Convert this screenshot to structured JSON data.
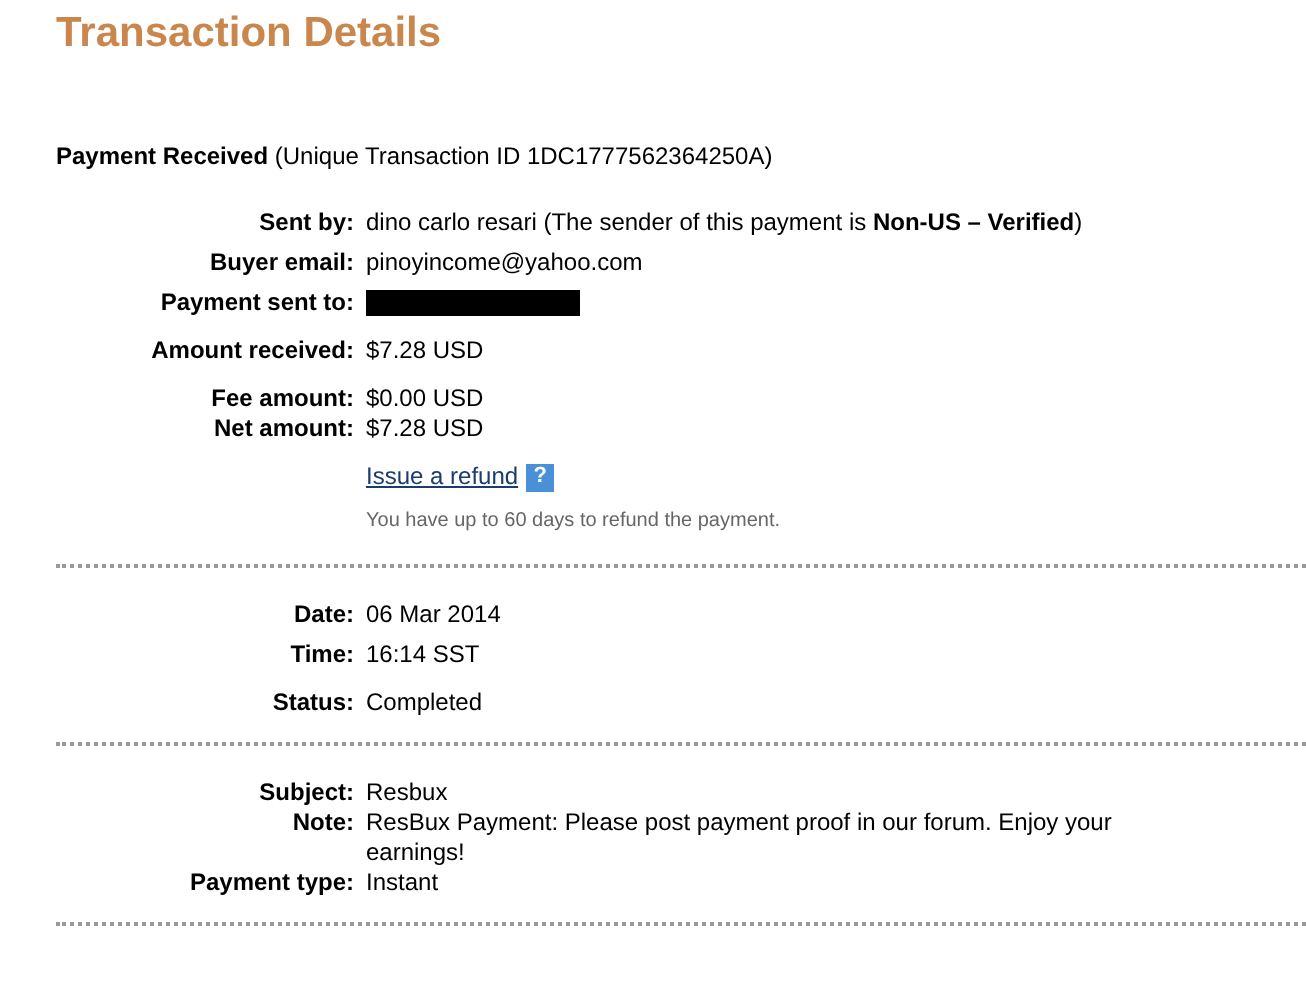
{
  "title": "Transaction Details",
  "header": "**Payment Received** (Unique Transaction ID 1DC1777562364250A)",
  "sections": [
    {
      "groups": [
        [
          {
            "kind": "text",
            "label": "Sent by:",
            "value": "dino carlo resari (The sender of this payment is **Non-US – Verified**)"
          },
          {
            "kind": "text",
            "label": "Buyer email:",
            "value": "pinoyincome@yahoo.com"
          },
          {
            "kind": "redacted",
            "label": "Payment sent to:"
          }
        ],
        [
          {
            "kind": "text",
            "label": "Amount received:",
            "value": "$7.28 USD"
          }
        ],
        [
          {
            "kind": "tight",
            "label": "Fee amount:",
            "value": "$0.00 USD"
          },
          {
            "kind": "tight",
            "label": "Net amount:",
            "value": "$7.28 USD"
          }
        ],
        [
          {
            "kind": "link",
            "value": "Issue a refund",
            "help": "?"
          },
          {
            "kind": "hint",
            "value": "You have up to 60 days to refund the payment."
          }
        ]
      ]
    },
    {
      "groups": [
        [
          {
            "kind": "text",
            "label": "Date:",
            "value": "06 Mar 2014"
          },
          {
            "kind": "text",
            "label": "Time:",
            "value": "16:14 SST"
          }
        ],
        [
          {
            "kind": "text",
            "label": "Status:",
            "value": "Completed"
          }
        ]
      ]
    },
    {
      "groups": [
        [
          {
            "kind": "text",
            "label": "Subject:",
            "value": "Resbux"
          },
          {
            "kind": "tight",
            "label": "Note:",
            "value": "ResBux Payment: Please post payment proof in our forum. Enjoy your earnings!"
          },
          {
            "kind": "tight",
            "label": "Payment type:",
            "value": "Instant"
          }
        ]
      ]
    }
  ]
}
